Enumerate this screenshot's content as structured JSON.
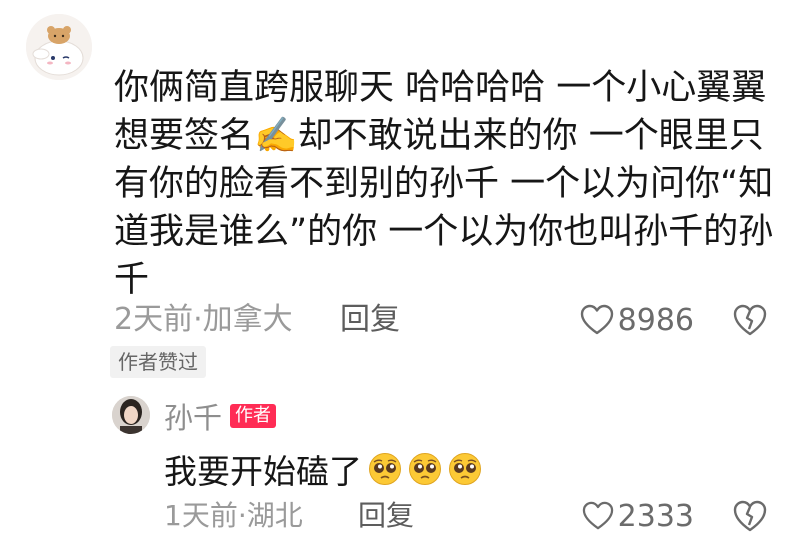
{
  "comment": {
    "text": "你俩简直跨服聊天 哈哈哈哈 一个小心翼翼想要签名✍️却不敢说出来的你 一个眼里只有你的脸看不到别的孙千 一个以为问你“知道我是谁么”的你 一个以为你也叫孙千的孙千",
    "time_location": "2天前·加拿大",
    "reply_label": "回复",
    "like_count": "8986",
    "author_liked_badge": "作者赞过"
  },
  "reply": {
    "username": "孙千",
    "author_tag": "作者",
    "text": "我要开始磕了",
    "emojis": [
      "pleading-face-icon",
      "pleading-face-icon",
      "pleading-face-icon"
    ],
    "time_location": "1天前·湖北",
    "reply_label": "回复",
    "like_count": "2333"
  },
  "colors": {
    "author_tag": "#ff2c55",
    "meta_text": "#9a9a9a",
    "body_text": "#161616"
  }
}
